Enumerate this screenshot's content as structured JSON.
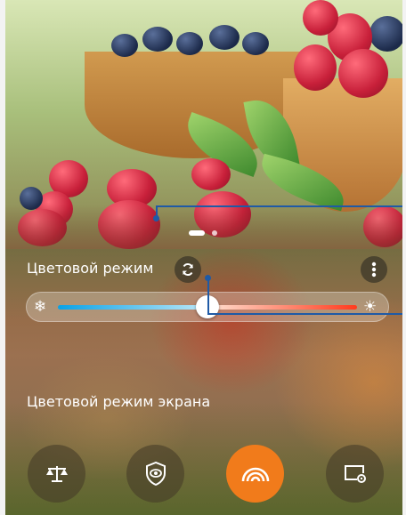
{
  "screen": {
    "title": "Цветовой режим",
    "reset_icon": "refresh-icon",
    "menu_icon": "more-vertical-icon"
  },
  "temperature_slider": {
    "cold_icon": "snowflake-icon",
    "warm_icon": "sun-icon",
    "value": 0.5
  },
  "carousel": {
    "page_count": 2,
    "active_page": 1
  },
  "section": {
    "label": "Цветовой режим экрана"
  },
  "modes": [
    {
      "icon": "balance-scale-icon",
      "active": false
    },
    {
      "icon": "eye-shield-icon",
      "active": false
    },
    {
      "icon": "vivid-rainbow-icon",
      "active": true
    },
    {
      "icon": "custom-screen-settings-icon",
      "active": false
    }
  ],
  "colors": {
    "accent": "#f17b1b",
    "callout": "#1f5aa6",
    "cold": "#0aa2e6",
    "warm": "#ff3b1d"
  }
}
